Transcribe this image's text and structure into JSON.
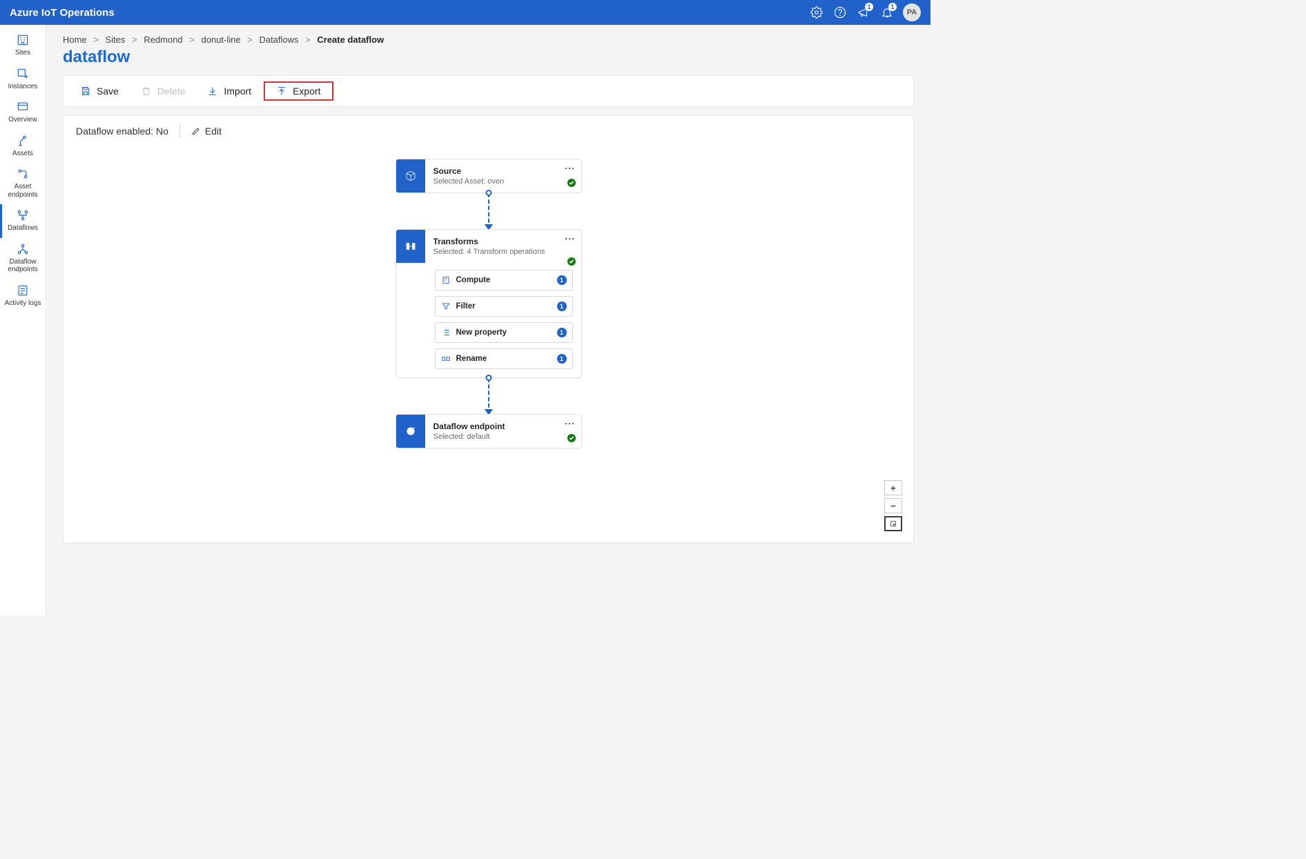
{
  "header": {
    "title": "Azure IoT Operations",
    "feedback_badge": "1",
    "notification_badge": "1",
    "avatar_initials": "PA"
  },
  "sidebar": {
    "items": [
      {
        "key": "sites",
        "label": "Sites"
      },
      {
        "key": "instances",
        "label": "Instances"
      },
      {
        "key": "overview",
        "label": "Overview"
      },
      {
        "key": "assets",
        "label": "Assets"
      },
      {
        "key": "asset-endpoints",
        "label": "Asset endpoints"
      },
      {
        "key": "dataflows",
        "label": "Dataflows"
      },
      {
        "key": "dataflow-endpoints",
        "label": "Dataflow endpoints"
      },
      {
        "key": "activity-logs",
        "label": "Activity logs"
      }
    ],
    "active_key": "dataflows"
  },
  "breadcrumb": [
    {
      "label": "Home"
    },
    {
      "label": "Sites"
    },
    {
      "label": "Redmond"
    },
    {
      "label": "donut-line"
    },
    {
      "label": "Dataflows"
    },
    {
      "label": "Create dataflow",
      "current": true
    }
  ],
  "page_title": "dataflow",
  "toolbar": {
    "save_label": "Save",
    "delete_label": "Delete",
    "import_label": "Import",
    "export_label": "Export"
  },
  "enabled_bar": {
    "text": "Dataflow enabled: No",
    "edit_label": "Edit"
  },
  "flow": {
    "source": {
      "title": "Source",
      "sub": "Selected Asset: oven",
      "status_ok": true
    },
    "transforms": {
      "title": "Transforms",
      "sub": "Selected: 4 Transform operations",
      "status_ok": true,
      "ops": [
        {
          "label": "Compute",
          "count": "1"
        },
        {
          "label": "Filter",
          "count": "1"
        },
        {
          "label": "New property",
          "count": "1"
        },
        {
          "label": "Rename",
          "count": "1"
        }
      ]
    },
    "endpoint": {
      "title": "Dataflow endpoint",
      "sub": "Selected: default",
      "status_ok": true
    }
  }
}
